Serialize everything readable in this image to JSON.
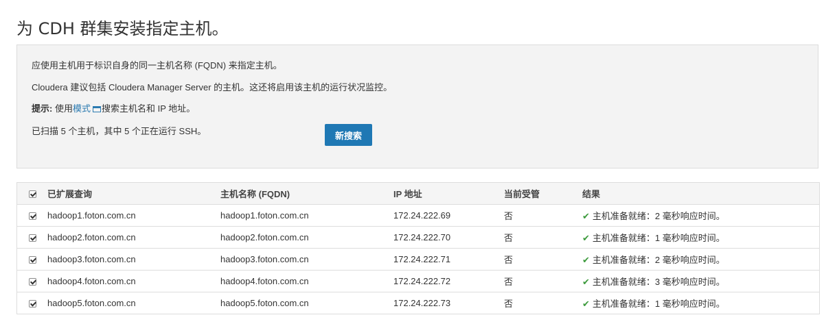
{
  "page": {
    "title": "为 CDH 群集安装指定主机。"
  },
  "info": {
    "line1": "应使用主机用于标识自身的同一主机名称 (FQDN) 来指定主机。",
    "line2": "Cloudera 建议包括 Cloudera Manager Server 的主机。这还将启用该主机的运行状况监控。",
    "tip_label": "提示:",
    "tip_prefix": " 使用",
    "tip_link": "模式",
    "tip_suffix": "搜索主机名和 IP 地址。",
    "scan_status": "已扫描 5 个主机，其中 5 个正在运行 SSH。",
    "new_search_button": "新搜索"
  },
  "table": {
    "headers": {
      "expanded_query": "已扩展查询",
      "hostname": "主机名称 (FQDN)",
      "ip": "IP 地址",
      "managed": "当前受管",
      "result": "结果"
    },
    "rows": [
      {
        "checked": true,
        "query": "hadoop1.foton.com.cn",
        "hostname": "hadoop1.foton.com.cn",
        "ip": "172.24.222.69",
        "managed": "否",
        "result": "主机准备就绪：2 毫秒响应时间。"
      },
      {
        "checked": true,
        "query": "hadoop2.foton.com.cn",
        "hostname": "hadoop2.foton.com.cn",
        "ip": "172.24.222.70",
        "managed": "否",
        "result": "主机准备就绪：1 毫秒响应时间。"
      },
      {
        "checked": true,
        "query": "hadoop3.foton.com.cn",
        "hostname": "hadoop3.foton.com.cn",
        "ip": "172.24.222.71",
        "managed": "否",
        "result": "主机准备就绪：2 毫秒响应时间。"
      },
      {
        "checked": true,
        "query": "hadoop4.foton.com.cn",
        "hostname": "hadoop4.foton.com.cn",
        "ip": "172.24.222.72",
        "managed": "否",
        "result": "主机准备就绪：3 毫秒响应时间。"
      },
      {
        "checked": true,
        "query": "hadoop5.foton.com.cn",
        "hostname": "hadoop5.foton.com.cn",
        "ip": "172.24.222.73",
        "managed": "否",
        "result": "主机准备就绪：1 毫秒响应时间。"
      }
    ]
  },
  "colors": {
    "accent": "#1f78b4",
    "link": "#2a7ab0",
    "ok": "#3c9a3c",
    "panel": "#f3f3f3"
  },
  "icons": {
    "tip": "keyboard-icon",
    "status": "check-icon",
    "select": "checkbox-icon"
  }
}
